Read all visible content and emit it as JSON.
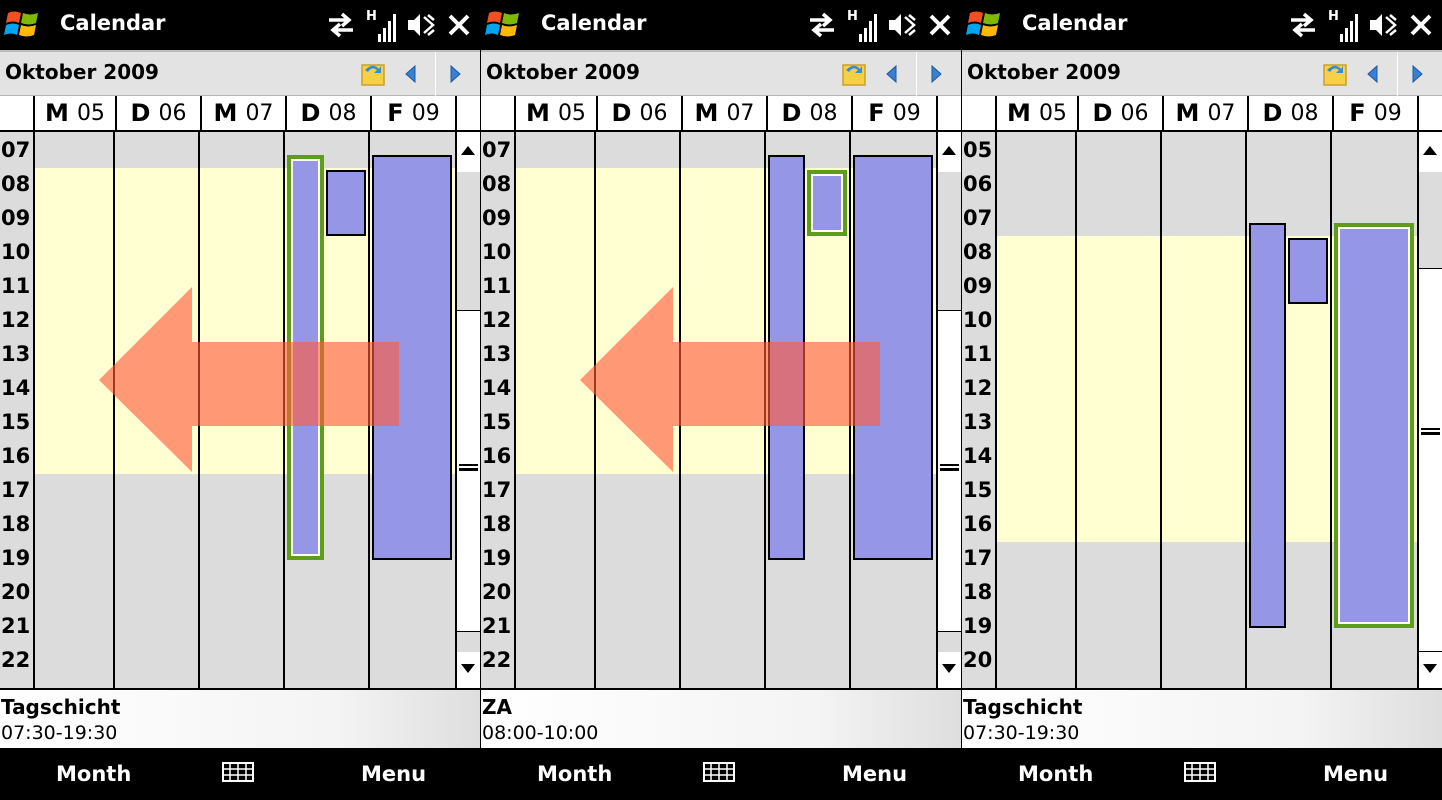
{
  "screens": [
    {
      "app_title": "Calendar",
      "month_title": "Oktober  2009",
      "days": [
        {
          "letter": "M",
          "num": "05"
        },
        {
          "letter": "D",
          "num": "06"
        },
        {
          "letter": "M",
          "num": "07"
        },
        {
          "letter": "D",
          "num": "08"
        },
        {
          "letter": "F",
          "num": "09"
        }
      ],
      "hours": [
        "07",
        "08",
        "09",
        "10",
        "11",
        "12",
        "13",
        "14",
        "15",
        "16",
        "17",
        "18",
        "19",
        "20",
        "21",
        "22"
      ],
      "info": {
        "title": "Tagschicht",
        "time": "07:30-19:30"
      },
      "softkeys": {
        "left": "Month",
        "right": "Menu",
        "middle_icon": "calendar-grid-icon"
      },
      "swipe_arrow": "left"
    },
    {
      "app_title": "Calendar",
      "month_title": "Oktober  2009",
      "days": [
        {
          "letter": "M",
          "num": "05"
        },
        {
          "letter": "D",
          "num": "06"
        },
        {
          "letter": "M",
          "num": "07"
        },
        {
          "letter": "D",
          "num": "08"
        },
        {
          "letter": "F",
          "num": "09"
        }
      ],
      "hours": [
        "07",
        "08",
        "09",
        "10",
        "11",
        "12",
        "13",
        "14",
        "15",
        "16",
        "17",
        "18",
        "19",
        "20",
        "21",
        "22"
      ],
      "info": {
        "title": "ZA",
        "time": "08:00-10:00"
      },
      "softkeys": {
        "left": "Month",
        "right": "Menu",
        "middle_icon": "calendar-grid-icon"
      },
      "swipe_arrow": "left"
    },
    {
      "app_title": "Calendar",
      "month_title": "Oktober  2009",
      "days": [
        {
          "letter": "M",
          "num": "05"
        },
        {
          "letter": "D",
          "num": "06"
        },
        {
          "letter": "M",
          "num": "07"
        },
        {
          "letter": "D",
          "num": "08"
        },
        {
          "letter": "F",
          "num": "09"
        }
      ],
      "hours": [
        "05",
        "06",
        "07",
        "08",
        "09",
        "10",
        "11",
        "12",
        "13",
        "14",
        "15",
        "16",
        "17",
        "18",
        "19",
        "20"
      ],
      "info": {
        "title": "Tagschicht",
        "time": "07:30-19:30"
      },
      "softkeys": {
        "left": "Month",
        "right": "Menu",
        "middle_icon": "calendar-grid-icon"
      },
      "swipe_arrow": "none"
    }
  ],
  "status_icons": [
    "sync-icon",
    "signal-h-icon",
    "speaker-muted-icon",
    "close-icon"
  ],
  "nav_icons": [
    "today-icon",
    "prev-week-icon",
    "next-week-icon"
  ],
  "colors": {
    "work_hours": "#ffffd2",
    "off_hours": "#dcdcdc",
    "appointment": "#9696e6",
    "selected_border": "#5e9d1a",
    "swipe_arrow": "#ff5a3c"
  }
}
